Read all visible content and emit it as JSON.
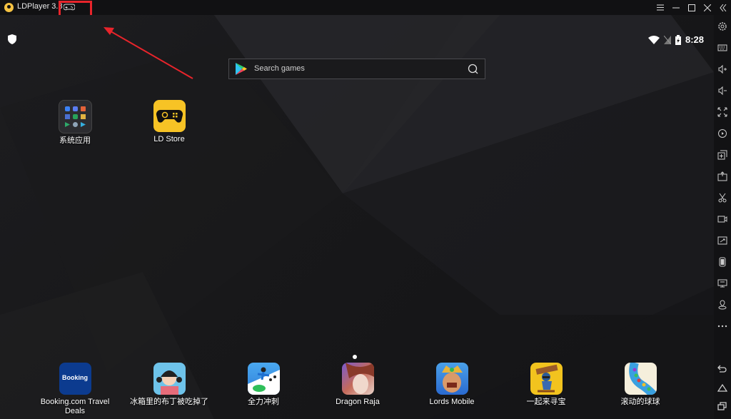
{
  "window": {
    "title": "LDPlayer 3.8",
    "controls": [
      "menu",
      "minimize",
      "maximize",
      "close",
      "collapse-sidebar"
    ]
  },
  "annotation": {
    "highlight_color": "#e8242b",
    "highlighted_item": "gamepad-icon"
  },
  "status_bar": {
    "time": "8:28"
  },
  "search": {
    "placeholder": "Search games"
  },
  "desktop_apps": [
    {
      "label": "系统应用"
    },
    {
      "label": "LD Store"
    }
  ],
  "dock_apps": [
    {
      "label": "Booking.com Travel Deals",
      "icon_text": "Booking"
    },
    {
      "label": "冰箱里的布丁被吃掉了"
    },
    {
      "label": "全力冲刺"
    },
    {
      "label": "Dragon Raja"
    },
    {
      "label": "Lords Mobile"
    },
    {
      "label": "一起来寻宝"
    },
    {
      "label": "滚动的球球"
    }
  ],
  "page_indicator": {
    "current": 1,
    "total": 1
  },
  "sidebar": {
    "items": [
      "settings",
      "keyboard-mapping",
      "volume-up",
      "volume-down",
      "fullscreen",
      "record-operation",
      "multi-instance",
      "install-apk",
      "screenshot",
      "record-video",
      "sync",
      "shake",
      "display",
      "location",
      "more",
      "back",
      "home",
      "recents"
    ]
  }
}
